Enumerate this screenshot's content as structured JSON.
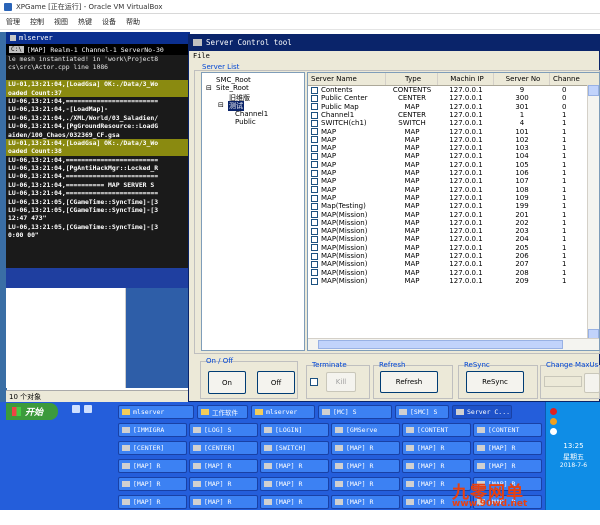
{
  "host": {
    "title": "XPGame [正在运行] - Oracle VM VirtualBox",
    "menu": [
      "管理",
      "控制",
      "视图",
      "热键",
      "设备",
      "帮助"
    ]
  },
  "console": {
    "title": "mlserver",
    "sub_tag": "C:\\",
    "sub_text": "[MAP]  Realm-1 Channel-1 ServerNo-30",
    "lines": [
      {
        "t": "le mesh instantiated! in 'work\\Project8",
        "s": ""
      },
      {
        "t": "cs\\src\\Actor.cpp line 1086",
        "s": ""
      },
      {
        "t": "",
        "s": ""
      },
      {
        "t": "LU-01,13:21:04,[LoadGsa] OK:./Data/3_Wo",
        "s": "y"
      },
      {
        "t": "oaded Count:37",
        "s": "y"
      },
      {
        "t": "LU-06,13:21:04,========================",
        "s": "w"
      },
      {
        "t": "LU-06,13:21:04,-[LoadMap]-",
        "s": "w"
      },
      {
        "t": "LU-06,13:21:04,./XML/World/03_Saladien/",
        "s": "w"
      },
      {
        "t": "LU-06,13:21:04,[PgGroundResource::LoadG",
        "s": "w"
      },
      {
        "t": "aiden/100_Chaos/032369_CF.gsa",
        "s": "w"
      },
      {
        "t": "LU-01,13:21:04,[LoadGsa] OK:./Data/3_Wo",
        "s": "y"
      },
      {
        "t": "oaded Count:38",
        "s": "y"
      },
      {
        "t": "LU-06,13:21:04,========================",
        "s": "w"
      },
      {
        "t": "LU-06,13:21:04,[PgAntiHackMgr::Locked_R",
        "s": "w"
      },
      {
        "t": "LU-06,13:21:04,========================",
        "s": "w"
      },
      {
        "t": "LU-06,13:21:04,========== MAP SERVER S",
        "s": "w"
      },
      {
        "t": "LU-06,13:21:04,========================",
        "s": "w"
      },
      {
        "t": "LU-06,13:21:05,[CGameTime::SyncTime]-[3",
        "s": "w"
      },
      {
        "t": "LU-06,13:21:05,[CGameTime::SyncTime]-[3",
        "s": "w"
      },
      {
        "t": "12:47 473\"",
        "s": "w"
      },
      {
        "t": "LU-06,13:21:05,[CGameTime::SyncTime]-[3",
        "s": "w"
      },
      {
        "t": "0:00 00\"",
        "s": "w"
      }
    ]
  },
  "explorer": {
    "status": "10 个对象"
  },
  "tool": {
    "title": "Server Control tool",
    "menu_file": "File",
    "server_list_label": "Server List",
    "tree": {
      "root": "SMC_Root",
      "site": "Site_Root",
      "node1": "旧维版",
      "node2": "测试",
      "child1": "Channel1",
      "child2": "Public"
    },
    "columns": [
      "Server Name",
      "Type",
      "Machin IP",
      "Server No",
      "Channe"
    ],
    "rows": [
      [
        "Contents",
        "CONTENTS",
        "127.0.0.1",
        "9",
        "0"
      ],
      [
        "Public Center",
        "CENTER",
        "127.0.0.1",
        "300",
        "0"
      ],
      [
        "Public Map",
        "MAP",
        "127.0.0.1",
        "301",
        "0"
      ],
      [
        "Channel1",
        "CENTER",
        "127.0.0.1",
        "1",
        "1"
      ],
      [
        "SWITCH(ch1)",
        "SWITCH",
        "127.0.0.1",
        "4",
        "1"
      ],
      [
        "MAP",
        "MAP",
        "127.0.0.1",
        "101",
        "1"
      ],
      [
        "MAP",
        "MAP",
        "127.0.0.1",
        "102",
        "1"
      ],
      [
        "MAP",
        "MAP",
        "127.0.0.1",
        "103",
        "1"
      ],
      [
        "MAP",
        "MAP",
        "127.0.0.1",
        "104",
        "1"
      ],
      [
        "MAP",
        "MAP",
        "127.0.0.1",
        "105",
        "1"
      ],
      [
        "MAP",
        "MAP",
        "127.0.0.1",
        "106",
        "1"
      ],
      [
        "MAP",
        "MAP",
        "127.0.0.1",
        "107",
        "1"
      ],
      [
        "MAP",
        "MAP",
        "127.0.0.1",
        "108",
        "1"
      ],
      [
        "MAP",
        "MAP",
        "127.0.0.1",
        "109",
        "1"
      ],
      [
        "Map(Testing)",
        "MAP",
        "127.0.0.1",
        "199",
        "1"
      ],
      [
        "MAP(Mission)",
        "MAP",
        "127.0.0.1",
        "201",
        "1"
      ],
      [
        "MAP(Mission)",
        "MAP",
        "127.0.0.1",
        "202",
        "1"
      ],
      [
        "MAP(Mission)",
        "MAP",
        "127.0.0.1",
        "203",
        "1"
      ],
      [
        "MAP(Mission)",
        "MAP",
        "127.0.0.1",
        "204",
        "1"
      ],
      [
        "MAP(Mission)",
        "MAP",
        "127.0.0.1",
        "205",
        "1"
      ],
      [
        "MAP(Mission)",
        "MAP",
        "127.0.0.1",
        "206",
        "1"
      ],
      [
        "MAP(Mission)",
        "MAP",
        "127.0.0.1",
        "207",
        "1"
      ],
      [
        "MAP(Mission)",
        "MAP",
        "127.0.0.1",
        "208",
        "1"
      ],
      [
        "MAP(Mission)",
        "MAP",
        "127.0.0.1",
        "209",
        "1"
      ]
    ],
    "onoff_label": "On / Off",
    "on_button": "On",
    "off_button": "Off",
    "terminate_label": "Terminate",
    "kill_button": "Kill",
    "refresh_label": "Refresh",
    "refresh_button": "Refresh",
    "resync_label": "ReSync",
    "resync_button": "ReSync",
    "change_label": "Change MaxUs"
  },
  "taskbar": {
    "start": "开始",
    "row1": [
      "mlserver",
      "工作软件",
      "mlserver",
      "[MC] S",
      "[SMC] S",
      "Server C..."
    ],
    "row2": [
      "[IMMIGRA",
      "[LOG] S",
      "[LOGIN]",
      "[GMServe",
      "[CONTENT",
      "[CONTENT"
    ],
    "row3": [
      "[CENTER]",
      "[CENTER]",
      "[SWITCH]",
      "[MAP] R",
      "[MAP] R",
      "[MAP] R"
    ],
    "row4": [
      "[MAP] R",
      "[MAP] R",
      "[MAP] R",
      "[MAP] R",
      "[MAP] R",
      "[MAP] R"
    ],
    "row5": [
      "[MAP] R",
      "[MAP] R",
      "[MAP] R",
      "[MAP] R",
      "[MAP] R",
      "[MAP] R"
    ],
    "row6": [
      "[MAP] R",
      "[MAP] R",
      "[MAP] R",
      "[MAP] R",
      "[MAP] R",
      "[MAP] R"
    ],
    "time": "13:25",
    "weekday": "星期五",
    "date": "2018-7-6"
  },
  "watermark": {
    "brand": "九零网单",
    "url": "www.90wd.net"
  },
  "colors": {
    "titlebar": "#0a246a",
    "taskbar": "#245edb",
    "console_highlight": "#8a8a10",
    "watermark": "#e84010"
  }
}
